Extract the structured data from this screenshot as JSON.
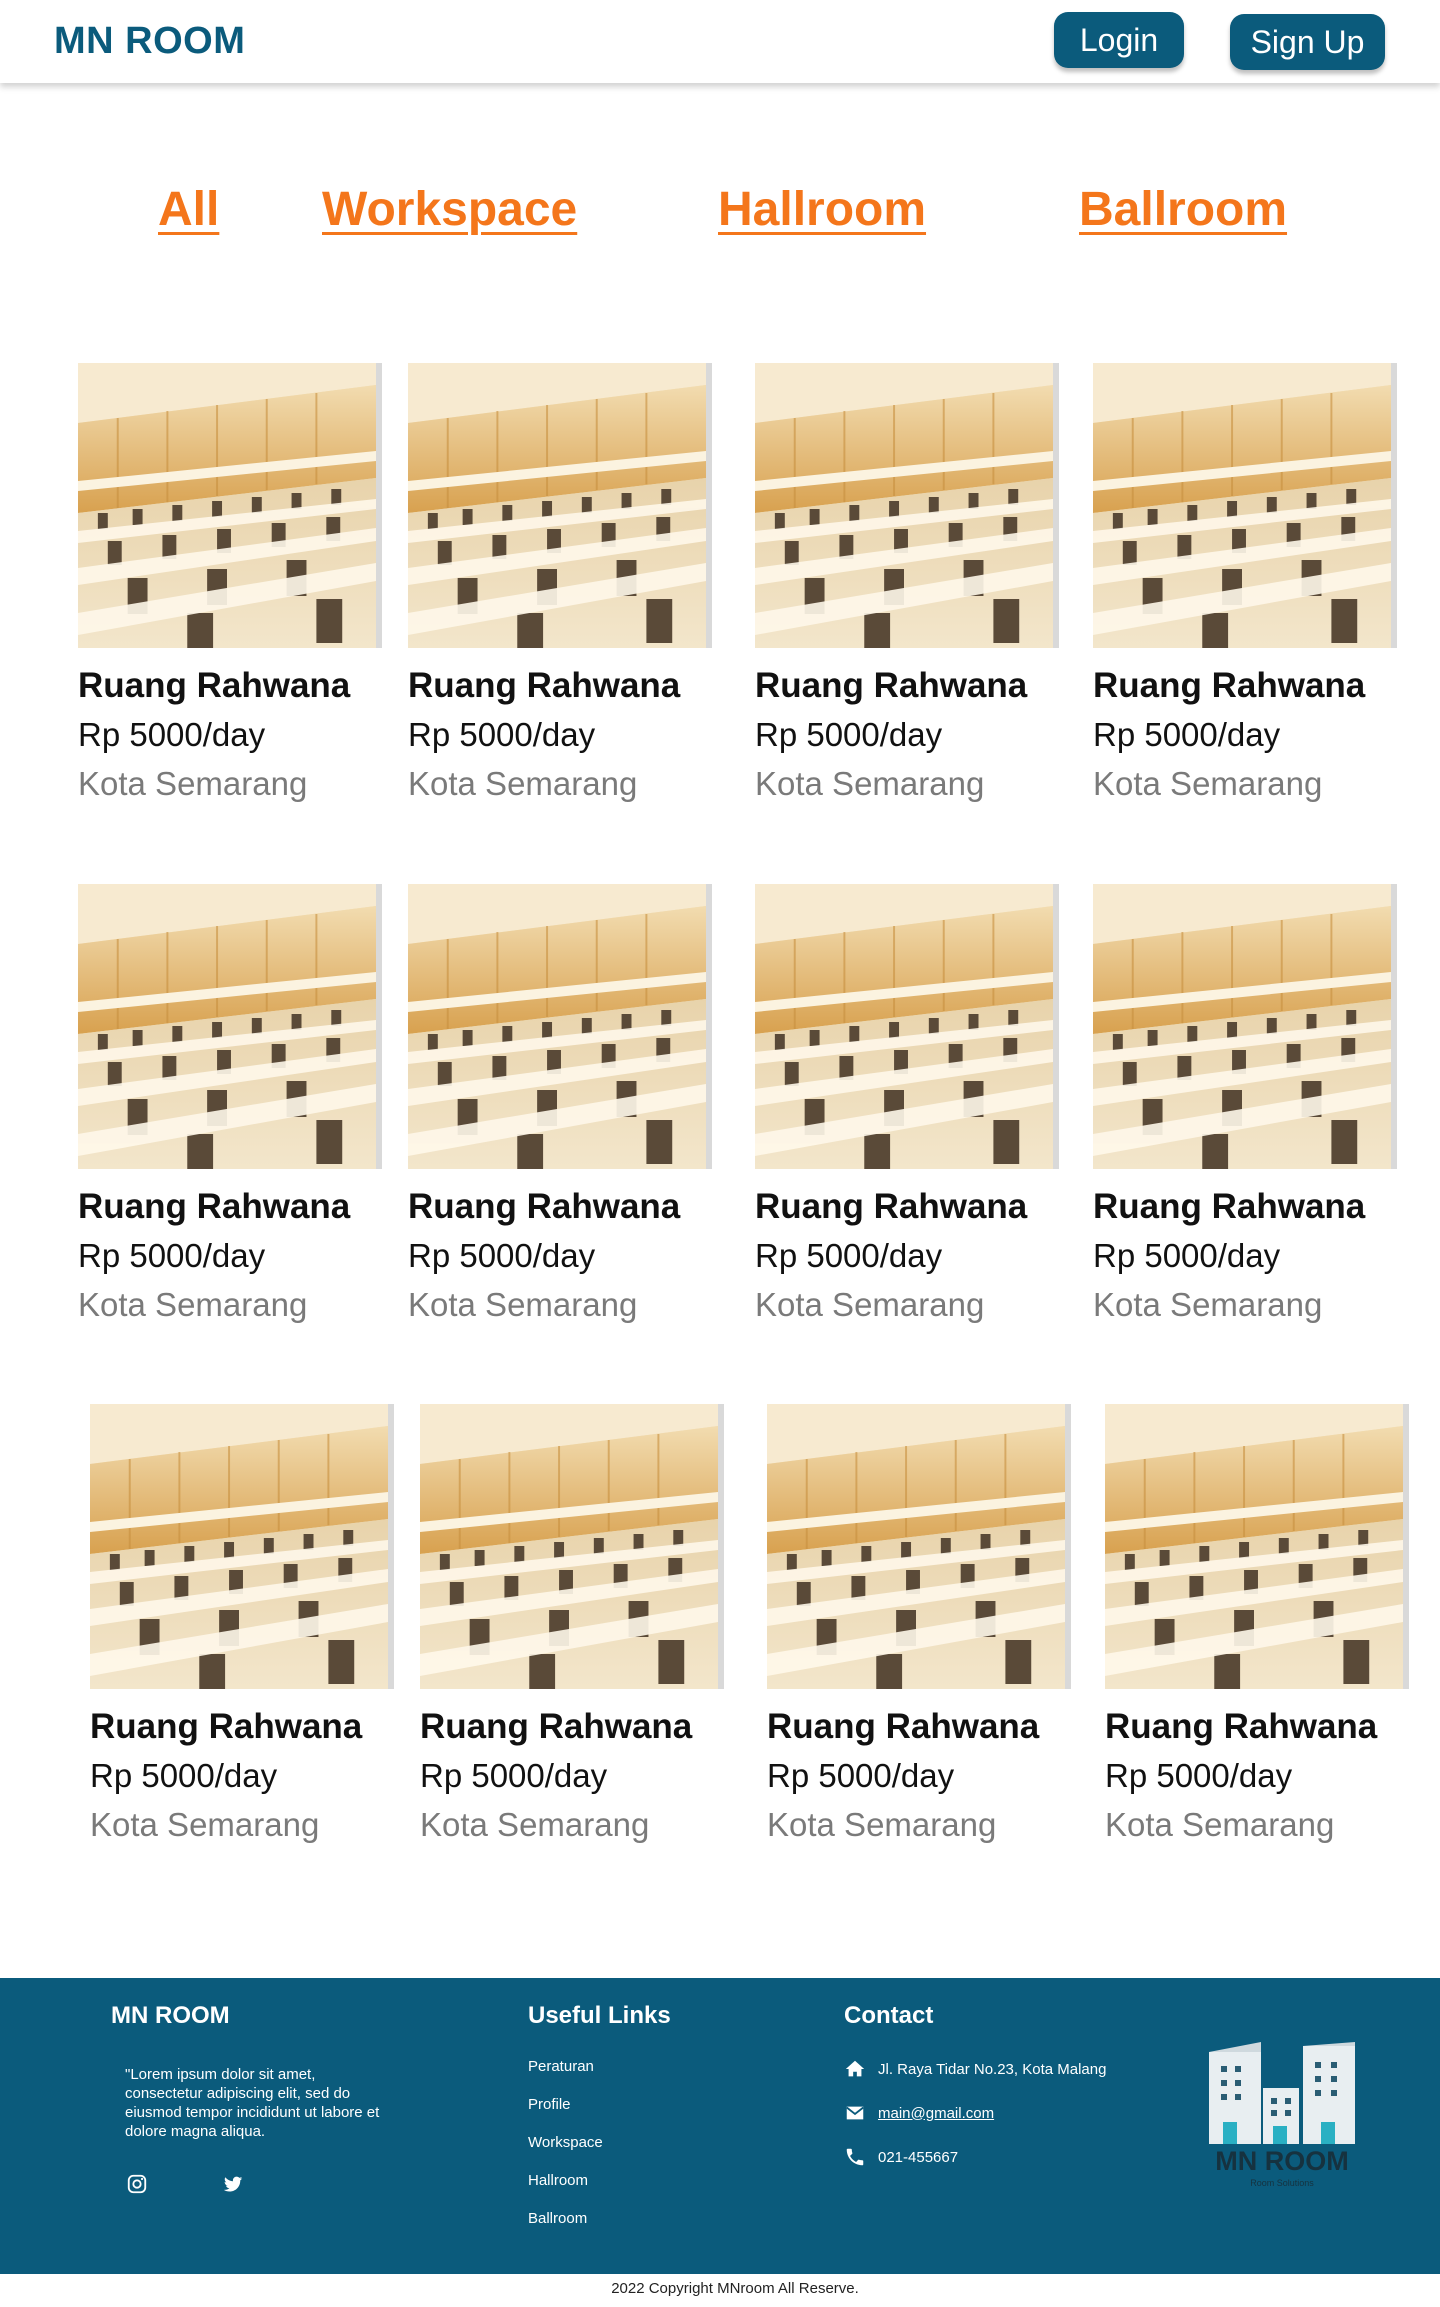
{
  "header": {
    "brand": "MN ROOM",
    "login_label": "Login",
    "signup_label": "Sign Up"
  },
  "tabs": [
    "All",
    "Workspace",
    "Hallroom",
    "Ballroom"
  ],
  "rooms": [
    {
      "title": "Ruang Rahwana",
      "price": "Rp 5000/day",
      "location": "Kota Semarang"
    },
    {
      "title": "Ruang Rahwana",
      "price": "Rp 5000/day",
      "location": "Kota Semarang"
    },
    {
      "title": "Ruang Rahwana",
      "price": "Rp 5000/day",
      "location": "Kota Semarang"
    },
    {
      "title": "Ruang Rahwana",
      "price": "Rp 5000/day",
      "location": "Kota Semarang"
    },
    {
      "title": "Ruang Rahwana",
      "price": "Rp 5000/day",
      "location": "Kota Semarang"
    },
    {
      "title": "Ruang Rahwana",
      "price": "Rp 5000/day",
      "location": "Kota Semarang"
    },
    {
      "title": "Ruang Rahwana",
      "price": "Rp 5000/day",
      "location": "Kota Semarang"
    },
    {
      "title": "Ruang Rahwana",
      "price": "Rp 5000/day",
      "location": "Kota Semarang"
    },
    {
      "title": "Ruang Rahwana",
      "price": "Rp 5000/day",
      "location": "Kota Semarang"
    },
    {
      "title": "Ruang Rahwana",
      "price": "Rp 5000/day",
      "location": "Kota Semarang"
    },
    {
      "title": "Ruang Rahwana",
      "price": "Rp 5000/day",
      "location": "Kota Semarang"
    },
    {
      "title": "Ruang Rahwana",
      "price": "Rp 5000/day",
      "location": "Kota Semarang"
    }
  ],
  "footer": {
    "brand": "MN ROOM",
    "description": "\"Lorem ipsum dolor sit amet, consectetur adipiscing elit, sed do eiusmod tempor incididunt ut labore et dolore magna aliqua.",
    "useful_links_heading": "Useful Links",
    "links": [
      "Peraturan",
      "Profile",
      "Workspace",
      "Hallroom",
      "Ballroom"
    ],
    "contact_heading": "Contact",
    "address": "Jl. Raya Tidar No.23, Kota Malang",
    "email": "main@gmail.com",
    "phone": "021-455667",
    "logo_title": "MN ROOM",
    "logo_subtitle": "Room Solutions",
    "icons": {
      "social": [
        "instagram-icon",
        "twitter-icon"
      ],
      "contact": [
        "home-icon",
        "mail-icon",
        "phone-icon"
      ]
    }
  },
  "copyright": "2022 Copyright MNroom All Reserve.",
  "colors": {
    "brand": "#0b5b7c",
    "accent": "#f4761b",
    "muted_text": "#7a7a7a"
  }
}
